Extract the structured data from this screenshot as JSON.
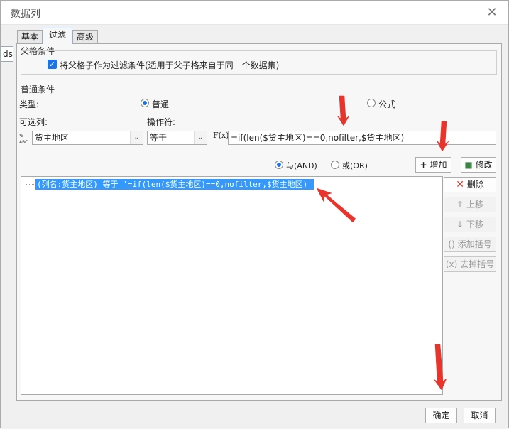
{
  "window": {
    "title": "数据列",
    "close_glyph": "✕"
  },
  "background": {
    "cell_text": "ds"
  },
  "tabs": [
    {
      "label": "基本",
      "active": false
    },
    {
      "label": "过滤",
      "active": true
    },
    {
      "label": "高级",
      "active": false
    }
  ],
  "parent_condition": {
    "section_label": "父格条件",
    "checkbox_label": "将父格子作为过滤条件(适用于父子格来自于同一个数据集)",
    "checked": true
  },
  "normal_condition": {
    "section_label": "普通条件",
    "type_label": "类型:",
    "type_normal": "普通",
    "type_formula": "公式",
    "selected_type": "普通",
    "column_label": "可选列:",
    "operator_label": "操作符:",
    "column_value": "货主地区",
    "operator_value": "等于",
    "formula_value": "=if(len($货主地区)==0,nofilter,$货主地区)",
    "fx_label": "F(x)"
  },
  "logic": {
    "and_label": "与(AND)",
    "or_label": "或(OR)",
    "selected": "AND"
  },
  "buttons": {
    "add": "增加",
    "modify": "修改",
    "delete": "删除",
    "move_up": "上移",
    "move_down": "下移",
    "add_bracket": "添加括号",
    "remove_bracket": "去掉括号",
    "ok": "确定",
    "cancel": "取消"
  },
  "condition_list": [
    "(列名:货主地区) 等于 '=if(len($货主地区)==0,nofilter,$货主地区)'"
  ],
  "colors": {
    "selection": "#3399ff",
    "checkbox": "#1a73e8",
    "annotation_arrow": "#e8342b",
    "delete_icon": "#e03c31"
  }
}
